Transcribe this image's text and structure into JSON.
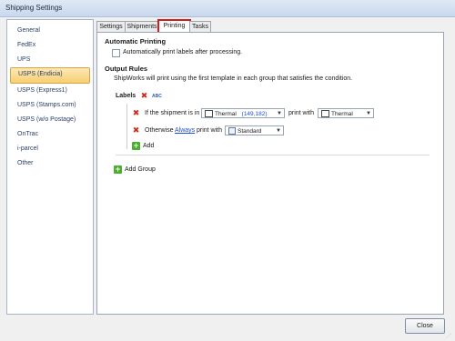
{
  "window": {
    "title": "Shipping Settings"
  },
  "sidebar": {
    "items": [
      {
        "label": "General",
        "selected": false
      },
      {
        "label": "FedEx",
        "selected": false
      },
      {
        "label": "UPS",
        "selected": false
      },
      {
        "label": "USPS (Endicia)",
        "selected": true
      },
      {
        "label": "USPS (Express1)",
        "selected": false
      },
      {
        "label": "USPS (Stamps.com)",
        "selected": false
      },
      {
        "label": "USPS (w/o Postage)",
        "selected": false
      },
      {
        "label": "OnTrac",
        "selected": false
      },
      {
        "label": "i-parcel",
        "selected": false
      },
      {
        "label": "Other",
        "selected": false
      }
    ]
  },
  "tabs": [
    {
      "label": "Settings"
    },
    {
      "label": "Shipments"
    },
    {
      "label": "Printing",
      "active": true
    },
    {
      "label": "Tasks"
    }
  ],
  "printing": {
    "automatic_heading": "Automatic Printing",
    "auto_print_label": "Automatically print labels after processing.",
    "auto_print_checked": false,
    "output_heading": "Output Rules",
    "output_desc": "ShipWorks will print using the first template in each group that satisfies the condition.",
    "group_label": "Labels",
    "abc_icon_text": "ABC",
    "rule1": {
      "prefix": "If the shipment is in",
      "filter_name": "Thermal",
      "filter_counts": "(149,182)",
      "middle": "print with",
      "template": "Thermal"
    },
    "rule2": {
      "prefix": "Otherwise",
      "link": "Always",
      "middle": "print with",
      "template": "Standard"
    },
    "add_label": "Add",
    "add_group_label": "Add Group"
  },
  "footer": {
    "close_label": "Close"
  },
  "colors": {
    "selection_bg": "#f7cf73",
    "tab_highlight": "#d01c1c",
    "link": "#1a4fd6",
    "delete_icon": "#d42a1e",
    "add_icon": "#4cb02f"
  }
}
